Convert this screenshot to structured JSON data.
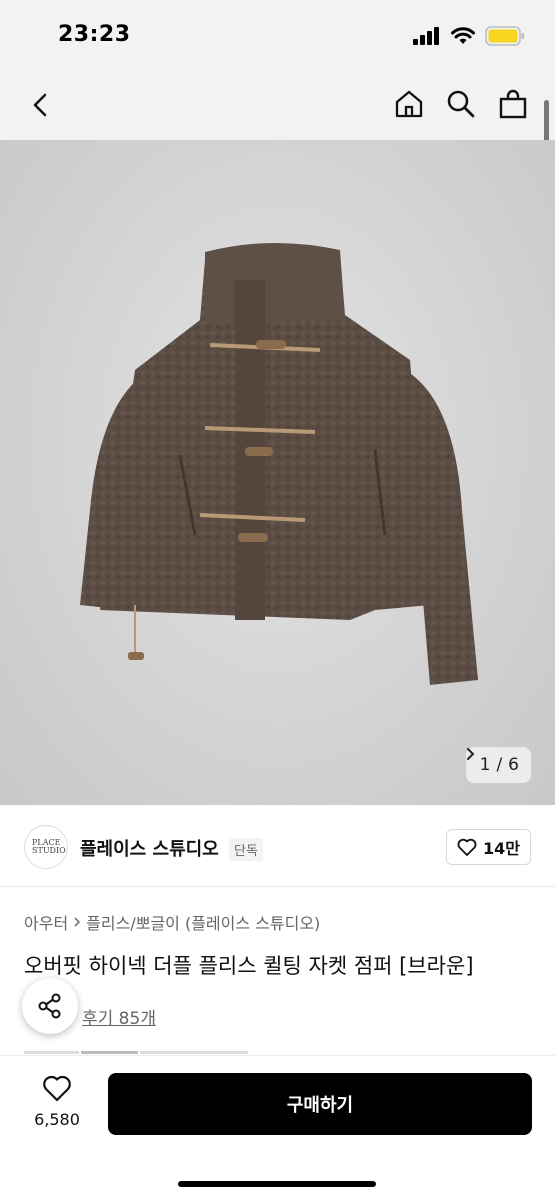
{
  "status": {
    "time": "23:23"
  },
  "gallery": {
    "current": "1",
    "separator": "/",
    "total": "6"
  },
  "brand": {
    "name": "플레이스 스튜디오",
    "badge": "단독",
    "likes": "14만",
    "logo_text": "PLACE STUDIO"
  },
  "product": {
    "category_root": "아우터",
    "category_sub": "플리스/뽀글이 (플레이스 스튜디오)",
    "title": "오버핏 하이넥 더플 플리스 퀼팅 자켓 점퍼 [브라운]",
    "reviews": "후기 85개"
  },
  "bottom": {
    "wish_count": "6,580",
    "buy_label": "구매하기"
  },
  "colors": {
    "hero_bg": "#d4d4d4",
    "jacket": "#5b4d44",
    "toggle": "#b89a77",
    "buy_bg": "#000000"
  }
}
